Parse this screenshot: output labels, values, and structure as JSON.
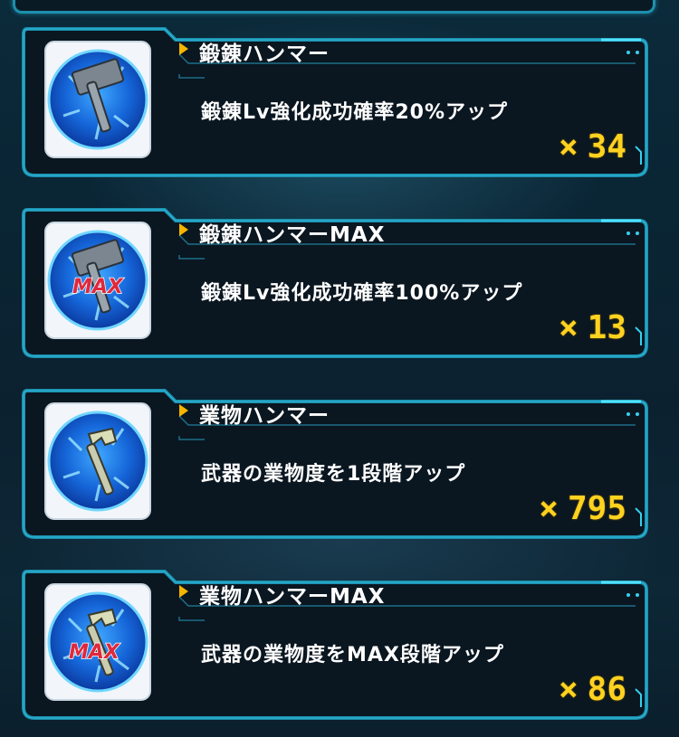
{
  "items": [
    {
      "name": "鍛錬ハンマー",
      "description": "鍛錬Lv強化成功確率20%アップ",
      "multiplier": "×",
      "count": "34",
      "icon": "forging-hammer-icon",
      "badge": ""
    },
    {
      "name": "鍛錬ハンマーMAX",
      "description": "鍛錬Lv強化成功確率100%アップ",
      "multiplier": "×",
      "count": "13",
      "icon": "forging-hammer-max-icon",
      "badge": "MAX"
    },
    {
      "name": "業物ハンマー",
      "description": "武器の業物度を1段階アップ",
      "multiplier": "×",
      "count": "795",
      "icon": "craft-hammer-icon",
      "badge": ""
    },
    {
      "name": "業物ハンマーMAX",
      "description": "武器の業物度をMAX段階アップ",
      "multiplier": "×",
      "count": "86",
      "icon": "craft-hammer-max-icon",
      "badge": "MAX"
    }
  ],
  "colors": {
    "frame": "#1d8fae",
    "frame_glow": "#35d0f0",
    "card_bg": "#0a1620",
    "count": "#ffd21f",
    "arrow": "#f5b400",
    "badge": "#e0283c"
  }
}
